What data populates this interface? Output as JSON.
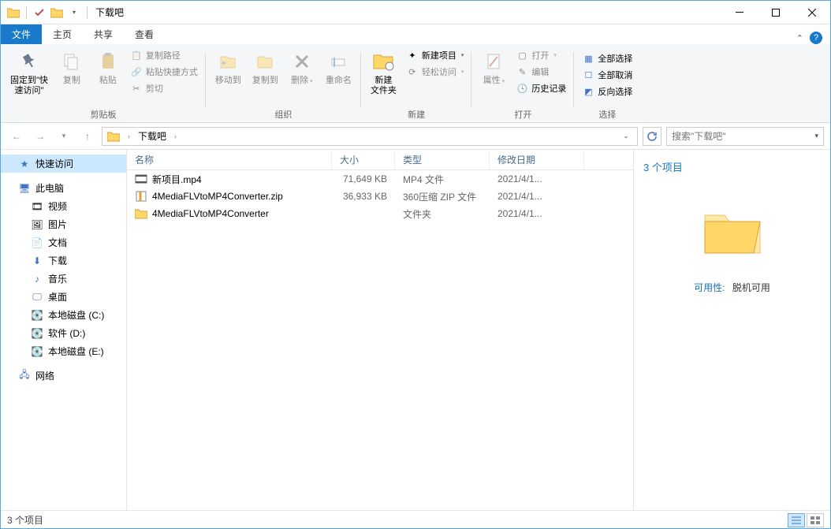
{
  "window": {
    "title": "下载吧"
  },
  "tabs": {
    "file": "文件",
    "home": "主页",
    "share": "共享",
    "view": "查看"
  },
  "ribbon": {
    "pin": "固定到\"快\n速访问\"",
    "copy": "复制",
    "paste": "粘贴",
    "copypath": "复制路径",
    "pasteshortcut": "粘贴快捷方式",
    "cut": "剪切",
    "clipboard_group": "剪贴板",
    "moveto": "移动到",
    "copyto": "复制到",
    "delete": "删除",
    "rename": "重命名",
    "organize_group": "组织",
    "newfolder": "新建\n文件夹",
    "newitem": "新建项目",
    "easyaccess": "轻松访问",
    "new_group": "新建",
    "properties": "属性",
    "open": "打开",
    "edit": "编辑",
    "history": "历史记录",
    "open_group": "打开",
    "selectall": "全部选择",
    "selectnone": "全部取消",
    "invert": "反向选择",
    "select_group": "选择"
  },
  "nav": {
    "breadcrumb": [
      "下载吧"
    ],
    "search_placeholder": "搜索\"下载吧\""
  },
  "sidebar": {
    "quick": "快速访问",
    "thispc": "此电脑",
    "videos": "视频",
    "pictures": "图片",
    "documents": "文档",
    "downloads": "下载",
    "music": "音乐",
    "desktop": "桌面",
    "diskc": "本地磁盘 (C:)",
    "diskd": "软件 (D:)",
    "diske": "本地磁盘 (E:)",
    "network": "网络"
  },
  "columns": {
    "name": "名称",
    "size": "大小",
    "type": "类型",
    "date": "修改日期"
  },
  "files": [
    {
      "name": "新项目.mp4",
      "size": "71,649 KB",
      "type": "MP4 文件",
      "date": "2021/4/1...",
      "icon": "video"
    },
    {
      "name": "4MediaFLVtoMP4Converter.zip",
      "size": "36,933 KB",
      "type": "360压缩 ZIP 文件",
      "date": "2021/4/1...",
      "icon": "zip"
    },
    {
      "name": "4MediaFLVtoMP4Converter",
      "size": "",
      "type": "文件夹",
      "date": "2021/4/1...",
      "icon": "folder"
    }
  ],
  "preview": {
    "count": "3 个项目",
    "avail_key": "可用性:",
    "avail_val": "脱机可用"
  },
  "status": {
    "text": "3 个项目"
  }
}
